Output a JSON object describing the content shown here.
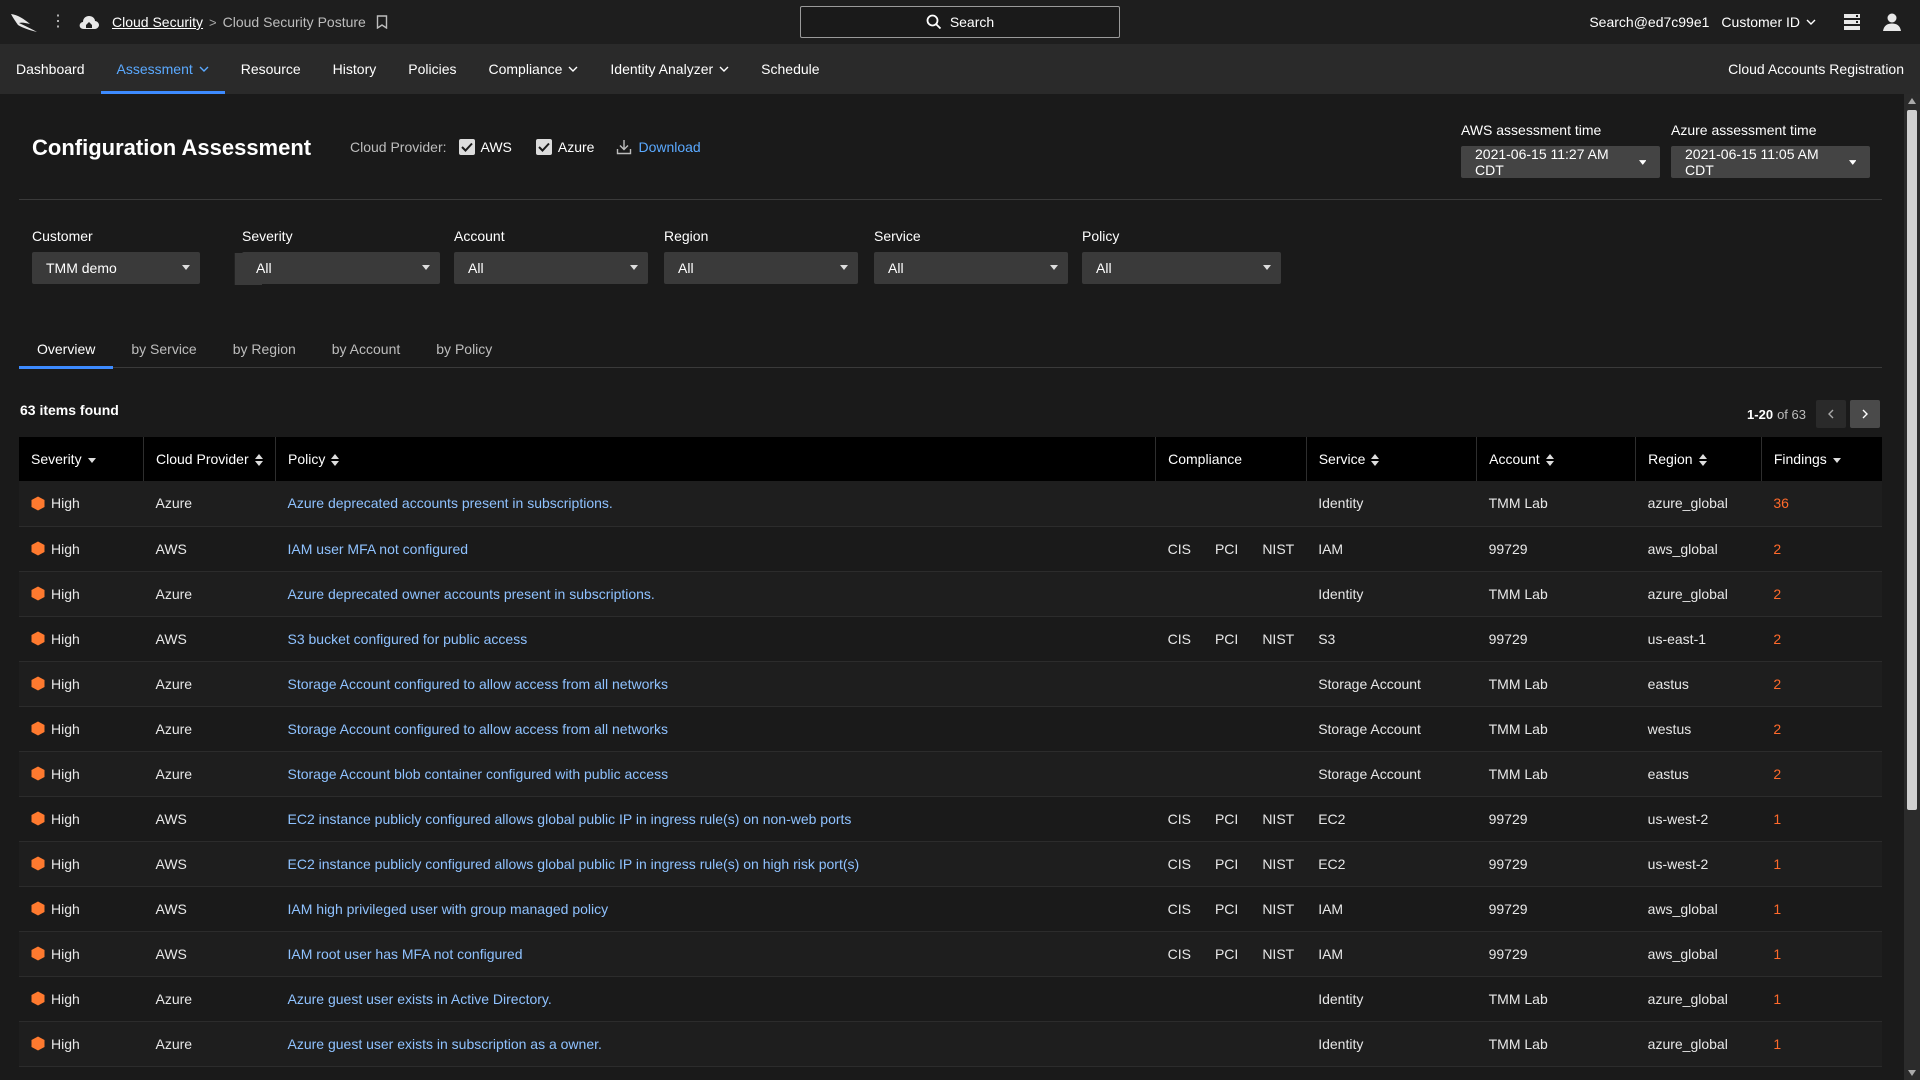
{
  "topbar": {
    "breadcrumb_link": "Cloud Security",
    "breadcrumb_sep": ">",
    "breadcrumb_current": "Cloud Security Posture",
    "search_label": "Search",
    "user": "Search@ed7c99e1",
    "customer_id": "Customer ID"
  },
  "nav": {
    "items": [
      {
        "label": "Dashboard"
      },
      {
        "label": "Assessment"
      },
      {
        "label": "Resource"
      },
      {
        "label": "History"
      },
      {
        "label": "Policies"
      },
      {
        "label": "Compliance"
      },
      {
        "label": "Identity Analyzer"
      },
      {
        "label": "Schedule"
      }
    ],
    "right_link": "Cloud Accounts Registration"
  },
  "header": {
    "title": "Configuration Assessment",
    "provider_label": "Cloud Provider:",
    "aws_label": "AWS",
    "azure_label": "Azure",
    "download_label": "Download",
    "aws_time_label": "AWS assessment time",
    "aws_time_value": "2021-06-15 11:27 AM CDT",
    "azure_time_label": "Azure assessment time",
    "azure_time_value": "2021-06-15 11:05 AM CDT"
  },
  "filters": {
    "customer": {
      "label": "Customer",
      "value": "TMM demo"
    },
    "severity": {
      "label": "Severity",
      "value": "All"
    },
    "account": {
      "label": "Account",
      "value": "All"
    },
    "region": {
      "label": "Region",
      "value": "All"
    },
    "service": {
      "label": "Service",
      "value": "All"
    },
    "policy": {
      "label": "Policy",
      "value": "All"
    }
  },
  "tabs": [
    {
      "label": "Overview"
    },
    {
      "label": "by Service"
    },
    {
      "label": "by Region"
    },
    {
      "label": "by Account"
    },
    {
      "label": "by Policy"
    }
  ],
  "results": {
    "count_text": "63 items found",
    "page_range": "1-20",
    "page_total": "of 63"
  },
  "table": {
    "headers": {
      "severity": "Severity",
      "provider": "Cloud Provider",
      "policy": "Policy",
      "compliance": "Compliance",
      "service": "Service",
      "account": "Account",
      "region": "Region",
      "findings": "Findings"
    },
    "rows": [
      {
        "severity": "High",
        "provider": "Azure",
        "policy": "Azure deprecated accounts present in subscriptions.",
        "c1": "",
        "c2": "",
        "c3": "",
        "service": "Identity",
        "account": "TMM Lab",
        "region": "azure_global",
        "findings": "36"
      },
      {
        "severity": "High",
        "provider": "AWS",
        "policy": "IAM user MFA not configured",
        "c1": "CIS",
        "c2": "PCI",
        "c3": "NIST",
        "service": "IAM",
        "account": "99729",
        "region": "aws_global",
        "findings": "2"
      },
      {
        "severity": "High",
        "provider": "Azure",
        "policy": "Azure deprecated owner accounts present in subscriptions.",
        "c1": "",
        "c2": "",
        "c3": "",
        "service": "Identity",
        "account": "TMM Lab",
        "region": "azure_global",
        "findings": "2"
      },
      {
        "severity": "High",
        "provider": "AWS",
        "policy": "S3 bucket configured for public access",
        "c1": "CIS",
        "c2": "PCI",
        "c3": "NIST",
        "service": "S3",
        "account": "99729",
        "region": "us-east-1",
        "findings": "2"
      },
      {
        "severity": "High",
        "provider": "Azure",
        "policy": "Storage Account configured to allow access from all networks",
        "c1": "",
        "c2": "",
        "c3": "",
        "service": "Storage Account",
        "account": "TMM Lab",
        "region": "eastus",
        "findings": "2"
      },
      {
        "severity": "High",
        "provider": "Azure",
        "policy": "Storage Account configured to allow access from all networks",
        "c1": "",
        "c2": "",
        "c3": "",
        "service": "Storage Account",
        "account": "TMM Lab",
        "region": "westus",
        "findings": "2"
      },
      {
        "severity": "High",
        "provider": "Azure",
        "policy": "Storage Account blob container configured with public access",
        "c1": "",
        "c2": "",
        "c3": "",
        "service": "Storage Account",
        "account": "TMM Lab",
        "region": "eastus",
        "findings": "2"
      },
      {
        "severity": "High",
        "provider": "AWS",
        "policy": "EC2 instance publicly configured allows global public IP in ingress rule(s) on non-web ports",
        "c1": "CIS",
        "c2": "PCI",
        "c3": "NIST",
        "service": "EC2",
        "account": "99729",
        "region": "us-west-2",
        "findings": "1"
      },
      {
        "severity": "High",
        "provider": "AWS",
        "policy": "EC2 instance publicly configured allows global public IP in ingress rule(s) on high risk port(s)",
        "c1": "CIS",
        "c2": "PCI",
        "c3": "NIST",
        "service": "EC2",
        "account": "99729",
        "region": "us-west-2",
        "findings": "1"
      },
      {
        "severity": "High",
        "provider": "AWS",
        "policy": "IAM high privileged user with group managed policy",
        "c1": "CIS",
        "c2": "PCI",
        "c3": "NIST",
        "service": "IAM",
        "account": "99729",
        "region": "aws_global",
        "findings": "1"
      },
      {
        "severity": "High",
        "provider": "AWS",
        "policy": "IAM root user has MFA not configured",
        "c1": "CIS",
        "c2": "PCI",
        "c3": "NIST",
        "service": "IAM",
        "account": "99729",
        "region": "aws_global",
        "findings": "1"
      },
      {
        "severity": "High",
        "provider": "Azure",
        "policy": "Azure guest user exists in Active Directory.",
        "c1": "",
        "c2": "",
        "c3": "",
        "service": "Identity",
        "account": "TMM Lab",
        "region": "azure_global",
        "findings": "1"
      },
      {
        "severity": "High",
        "provider": "Azure",
        "policy": "Azure guest user exists in subscription as a owner.",
        "c1": "",
        "c2": "",
        "c3": "",
        "service": "Identity",
        "account": "TMM Lab",
        "region": "azure_global",
        "findings": "1"
      }
    ]
  },
  "colors": {
    "accent": "#3d8bff",
    "link": "#8fc2ff",
    "severity_high": "#ff7a2f",
    "findings": "#ff6a2b"
  }
}
